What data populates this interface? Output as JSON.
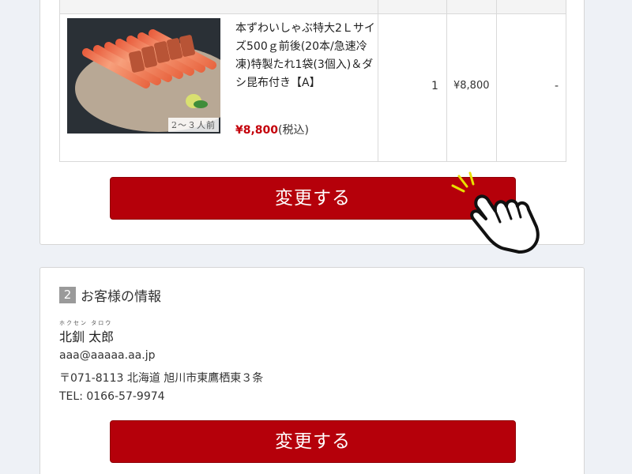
{
  "cart": {
    "item": {
      "name": "本ずわいしゃぶ特大2Ｌサイズ500ｇ前後(20本/急速冷凍)特製たれ1袋(3個入)＆ダシ昆布付き【A】",
      "price": "¥8,800",
      "tax_note": "(税込)",
      "image_badge": "2～３人前",
      "quantity": "1",
      "subtotal": "¥8,800",
      "extra": "-"
    },
    "change_button": "変更する"
  },
  "customer": {
    "section_number": "2",
    "section_title": "お客様の情報",
    "furigana": "ホクセン タロウ",
    "name": "北釧 太郎",
    "email": "aaa@aaaaa.aa.jp",
    "address": "〒071-8113 北海道 旭川市東鷹栖東３条",
    "tel": "TEL: 0166-57-9974",
    "change_button": "変更する"
  },
  "colors": {
    "accent_red": "#b5000a",
    "price_red": "#c4000a",
    "background": "#eef1f6"
  },
  "icons": {
    "pointer": "pointing-hand-icon"
  }
}
